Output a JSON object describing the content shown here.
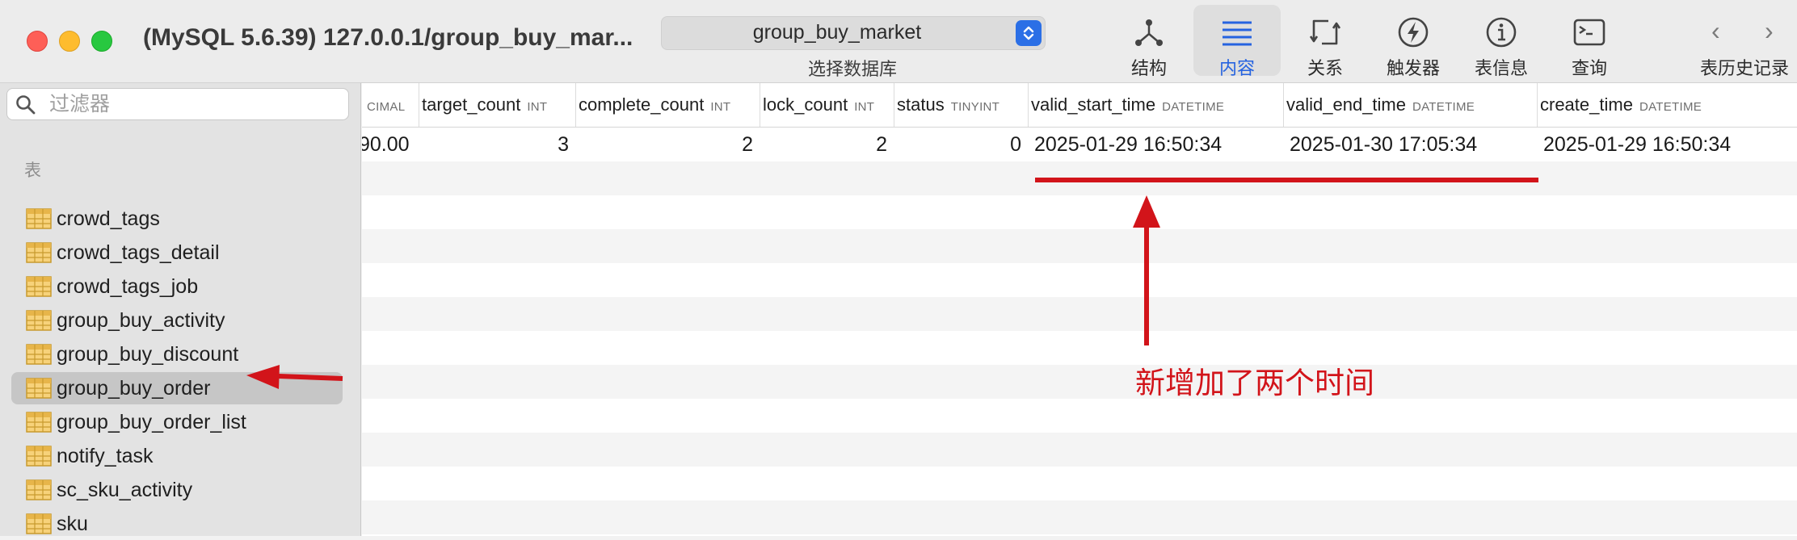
{
  "window": {
    "title": "(MySQL 5.6.39) 127.0.0.1/group_buy_mar...",
    "controls": [
      "close",
      "minimize",
      "maximize"
    ]
  },
  "database_selector": {
    "value": "group_buy_market",
    "caption": "选择数据库"
  },
  "toolbar": {
    "items": [
      {
        "label": "结构",
        "icon": "structure-icon",
        "active": false
      },
      {
        "label": "内容",
        "icon": "content-list-icon",
        "active": true
      },
      {
        "label": "关系",
        "icon": "relations-icon",
        "active": false
      },
      {
        "label": "触发器",
        "icon": "trigger-icon",
        "active": false
      },
      {
        "label": "表信息",
        "icon": "info-icon",
        "active": false
      },
      {
        "label": "查询",
        "icon": "query-terminal-icon",
        "active": false
      }
    ],
    "history_label": "表历史记录",
    "back_glyph": "‹",
    "forward_glyph": "›"
  },
  "sidebar": {
    "filter_placeholder": "过滤器",
    "section_title": "表",
    "tables": [
      {
        "name": "crowd_tags"
      },
      {
        "name": "crowd_tags_detail"
      },
      {
        "name": "crowd_tags_job"
      },
      {
        "name": "group_buy_activity"
      },
      {
        "name": "group_buy_discount"
      },
      {
        "name": "group_buy_order"
      },
      {
        "name": "group_buy_order_list"
      },
      {
        "name": "notify_task"
      },
      {
        "name": "sc_sku_activity"
      },
      {
        "name": "sku"
      }
    ],
    "selected_index": 5
  },
  "grid": {
    "columns": [
      {
        "name": "",
        "type": "CIMAL"
      },
      {
        "name": "target_count",
        "type": "INT"
      },
      {
        "name": "complete_count",
        "type": "INT"
      },
      {
        "name": "lock_count",
        "type": "INT"
      },
      {
        "name": "status",
        "type": "TINYINT"
      },
      {
        "name": "valid_start_time",
        "type": "DATETIME"
      },
      {
        "name": "valid_end_time",
        "type": "DATETIME"
      },
      {
        "name": "create_time",
        "type": "DATETIME"
      }
    ],
    "rows": [
      [
        "90.00",
        "3",
        "2",
        "2",
        "0",
        "2025-01-29 16:50:34",
        "2025-01-30 17:05:34",
        "2025-01-29 16:50:34"
      ]
    ]
  },
  "annotation": {
    "text": "新增加了两个时间",
    "color": "#d2141a"
  },
  "colors": {
    "accent": "#2563e0",
    "toolbar_bg": "#ececec",
    "sidebar_bg": "#e3e3e3",
    "selected_row_bg": "#c6c6c6",
    "stripe_bg": "#f4f4f4"
  }
}
